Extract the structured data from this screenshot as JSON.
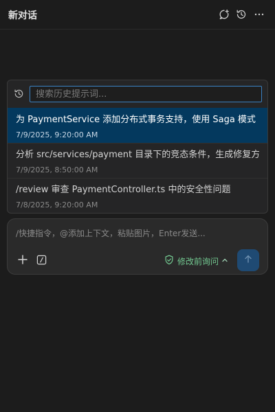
{
  "header": {
    "title": "新对话"
  },
  "history": {
    "search_placeholder": "搜索历史提示词...",
    "items": [
      {
        "query": "为 PaymentService 添加分布式事务支持，使用 Saga 模式",
        "time": "7/9/2025, 9:20:00 AM"
      },
      {
        "query": "分析 src/services/payment 目录下的竞态条件，生成修复方案",
        "time": "7/9/2025, 8:50:00 AM"
      },
      {
        "query": "/review 审查 PaymentController.ts 中的安全性问题",
        "time": "7/8/2025, 9:20:00 AM"
      }
    ]
  },
  "composer": {
    "placeholder": "/快捷指令，@添加上下文，粘贴图片，Enter发送...",
    "mode_label": "修改前询问"
  },
  "icons": {
    "new_chat": "new-chat-icon",
    "history": "history-icon",
    "more": "more-icon",
    "plus": "plus-icon",
    "slash": "slash-command-icon",
    "shield": "shield-check-icon",
    "chevron": "chevron-up-icon",
    "send": "arrow-up-icon"
  },
  "colors": {
    "accent": "#3b82c4",
    "selected": "#04395e",
    "mode": "#73c991",
    "send_bg": "#1f4a73"
  }
}
